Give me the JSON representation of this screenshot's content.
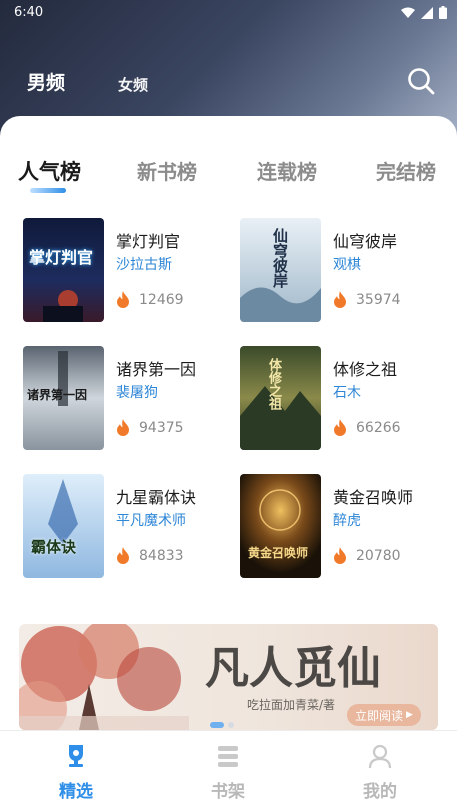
{
  "status_bar": {
    "time": "6:40"
  },
  "header": {
    "gender_tabs": [
      {
        "label": "男频",
        "active": true
      },
      {
        "label": "女频",
        "active": false
      }
    ],
    "search_icon": "search-icon"
  },
  "rank_tabs": [
    {
      "label": "人气榜",
      "active": true
    },
    {
      "label": "新书榜",
      "active": false
    },
    {
      "label": "连载榜",
      "active": false
    },
    {
      "label": "完结榜",
      "active": false
    }
  ],
  "books": [
    {
      "title": "掌灯判官",
      "author": "沙拉古斯",
      "heat": "12469",
      "cover_text": "掌灯判官"
    },
    {
      "title": "仙穹彼岸",
      "author": "观棋",
      "heat": "35974",
      "cover_text": "仙穹彼岸"
    },
    {
      "title": "诸界第一因",
      "author": "裴屠狗",
      "heat": "94375",
      "cover_text": "诸界第一因"
    },
    {
      "title": "体修之祖",
      "author": "石木",
      "heat": "66266",
      "cover_text": "体修之祖"
    },
    {
      "title": "九星霸体诀",
      "author": "平凡魔术师",
      "heat": "84833",
      "cover_text": "霸体诀"
    },
    {
      "title": "黄金召唤师",
      "author": "醉虎",
      "heat": "20780",
      "cover_text": "黄金召唤师"
    }
  ],
  "banner": {
    "title": "凡人觅仙",
    "subtitle": "吃拉面加青菜/著",
    "button_label": "立即阅读"
  },
  "bottom_nav": [
    {
      "label": "精选",
      "icon": "trophy-icon",
      "active": true
    },
    {
      "label": "书架",
      "icon": "bookshelf-icon",
      "active": false
    },
    {
      "label": "我的",
      "icon": "user-icon",
      "active": false
    }
  ],
  "colors": {
    "accent": "#2f8fe8",
    "author": "#2e86d6",
    "fire": "#f07a2a"
  }
}
